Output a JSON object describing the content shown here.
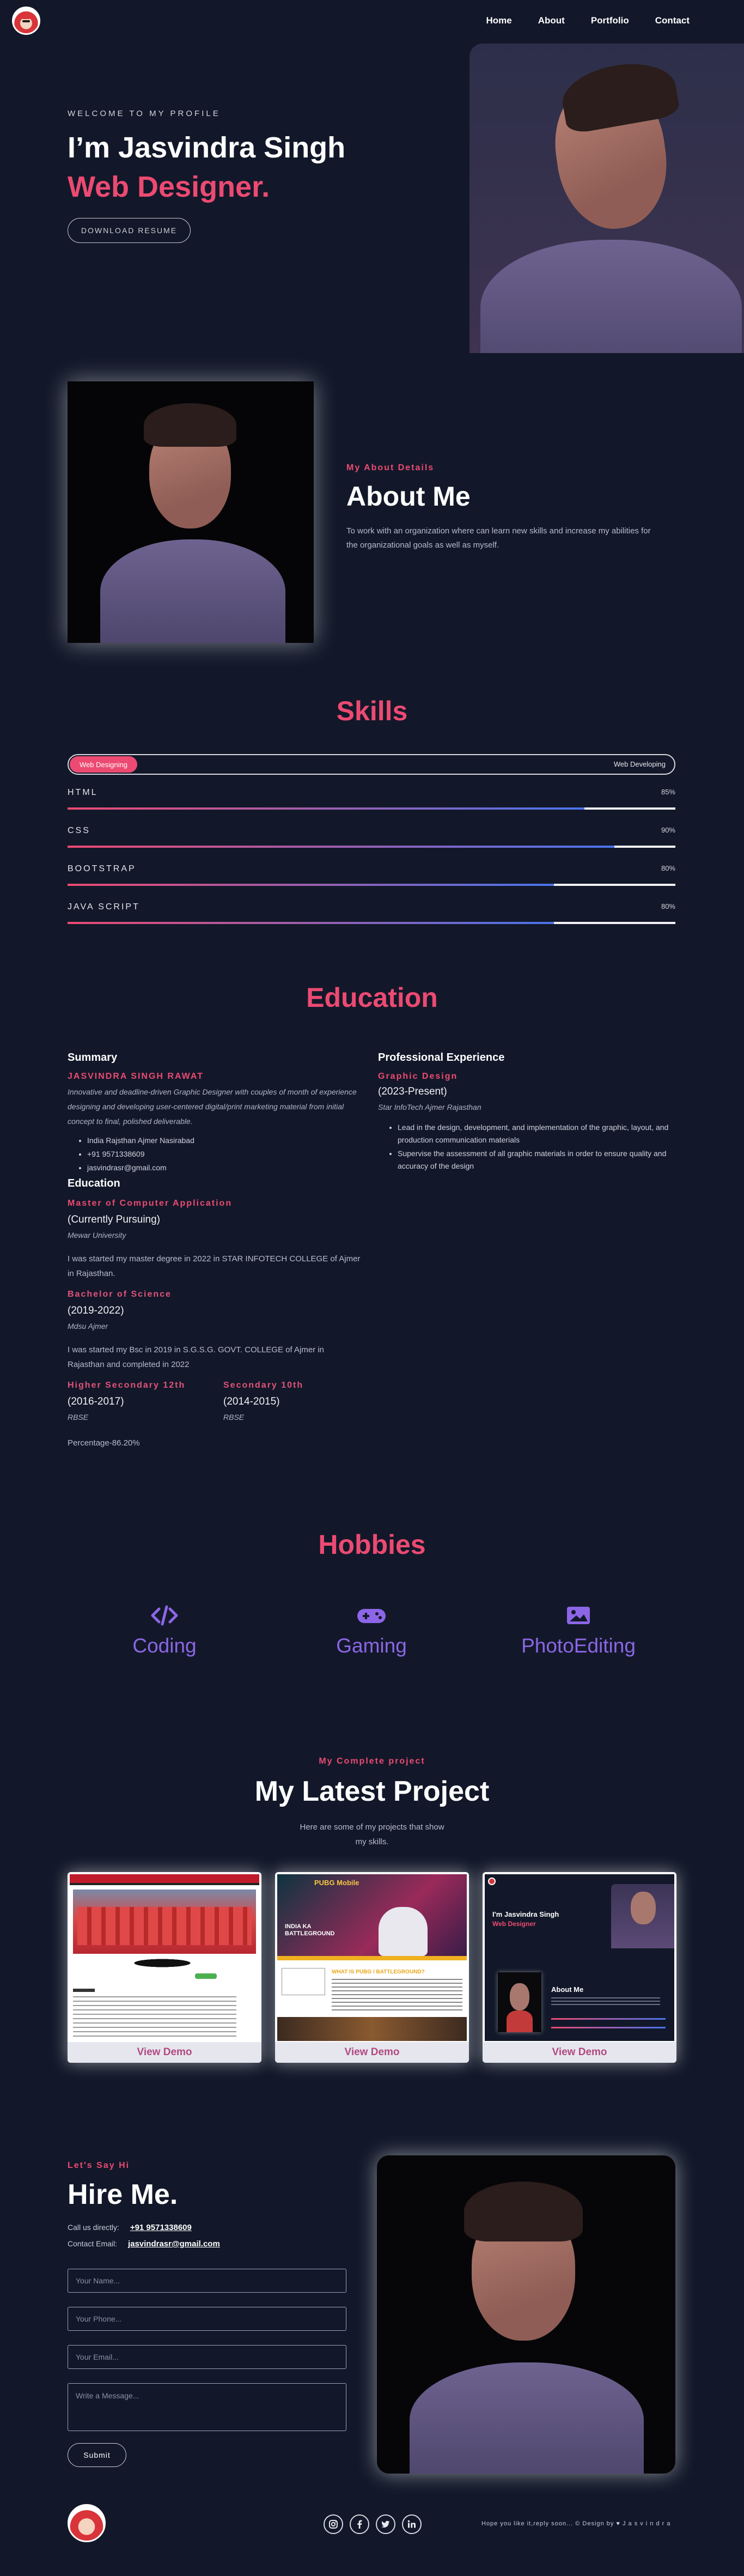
{
  "nav": {
    "items": [
      "Home",
      "About",
      "Portfolio",
      "Contact"
    ]
  },
  "hero": {
    "welcome": "WELCOME TO MY PROFILE",
    "name": "I’m Jasvindra Singh",
    "role": "Web Designer.",
    "button": "DOWNLOAD RESUME"
  },
  "about": {
    "kicker": "My About Details",
    "title": "About Me",
    "text": "To work with an organization where can learn new skills and increase my abilities for the organizational goals as well as myself."
  },
  "skills": {
    "title": "Skills",
    "tab_active": "Web Designing",
    "tab_inactive": "Web Developing",
    "items": [
      {
        "name": "HTML",
        "percent_label": "85%",
        "level": 0.85
      },
      {
        "name": "CSS",
        "percent_label": "90%",
        "level": 0.9
      },
      {
        "name": "BOOTSTRAP",
        "percent_label": "80%",
        "level": 0.8
      },
      {
        "name": "JAVA SCRIPT",
        "percent_label": "80%",
        "level": 0.8
      }
    ]
  },
  "education": {
    "title": "Education",
    "summary_heading": "Summary",
    "summary_name": "JASVINDRA SINGH RAWAT",
    "summary_text": "Innovative and deadline-driven Graphic Designer with couples of month of experience designing and developing user-centered digital/print marketing material from initial concept to final, polished deliverable.",
    "contacts": [
      "India Rajsthan Ajmer Nasirabad",
      "+91 9571338609",
      "jasvindrasr@gmail.com"
    ],
    "edu_heading": "Education",
    "mca_title": "Master of Computer Application",
    "mca_period": "(Currently Pursuing)",
    "mca_place": "Mewar University",
    "mca_text": "I was started my master degree in 2022 in STAR INFOTECH COLLEGE of Ajmer in Rajasthan.",
    "bsc_title": "Bachelor of Science",
    "bsc_period": "(2019-2022)",
    "bsc_place": "Mdsu Ajmer",
    "bsc_text": "I was started my Bsc in 2019 in S.G.S.G. GOVT. COLLEGE of Ajmer in Rajasthan and completed in 2022",
    "hs_title": "Higher Secondary 12th",
    "hs_period": "(2016-2017)",
    "hs_board": "RBSE",
    "sec_title": "Secondary 10th",
    "sec_period": "(2014-2015)",
    "sec_board": "RBSE",
    "percentage": "Percentage-86.20%",
    "prof_heading": "Professional Experience",
    "prof_role": "Graphic Design",
    "prof_period": "(2023-Present)",
    "prof_place": "Star InfoTech Ajmer Rajasthan",
    "prof_bullets": [
      "Lead in the design, development, and implementation of the graphic, layout, and production communication materials",
      "Supervise the assessment of all graphic materials in order to ensure quality and accuracy of the design"
    ]
  },
  "hobbies": {
    "title": "Hobbies",
    "items": [
      {
        "label": "Coding",
        "icon": "code-icon"
      },
      {
        "label": "Gaming",
        "icon": "gamepad-icon"
      },
      {
        "label": "PhotoEditing",
        "icon": "image-icon"
      }
    ]
  },
  "projects": {
    "kicker": "My Complete project",
    "title": "My Latest Project",
    "subtitle_line1": "Here are some of my projects that show",
    "subtitle_line2": "my skills.",
    "demo_label": "View Demo",
    "thumb_texts": {
      "pubg_logo": "PUBG Mobile",
      "pubg_heading": "INDIA KA BATTLEGROUND",
      "pubg_banner": "WHAT IS PUBG / BATTLEGROUND?",
      "portfolio_name": "I'm Jasvindra Singh",
      "portfolio_role": "Web Designer",
      "portfolio_about": "About Me"
    }
  },
  "hire": {
    "kicker": "Let's Say Hi",
    "title": "Hire Me.",
    "call_label": "Call us directly:",
    "call_value": "+91 9571338609",
    "email_label": "Contact Email:",
    "email_value": "jasvindrasr@gmail.com",
    "placeholders": {
      "name": "Your Name...",
      "phone": "Your Phone...",
      "email": "Your Email...",
      "message": "Write a Message..."
    },
    "submit": "Submit"
  },
  "footer": {
    "note": "Hope you like it,reply soon... © Design by ♥ J a s v i n d r a"
  },
  "colors": {
    "background": "#121829",
    "accent": "#ec4a72",
    "accent_blue": "#4a74ec",
    "hobby_purple": "#8c66e6"
  }
}
